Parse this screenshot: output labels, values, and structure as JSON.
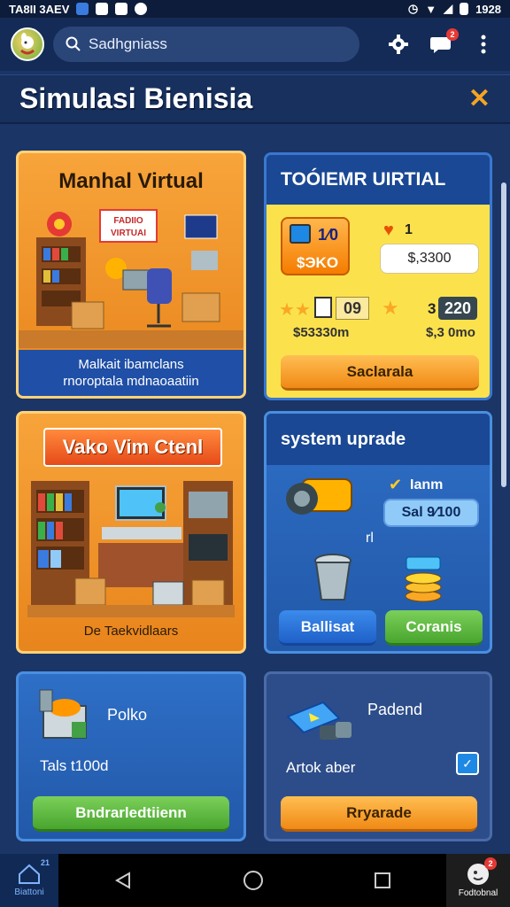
{
  "status": {
    "left_text": "TA8II 3AEV",
    "time": "1928"
  },
  "search": {
    "placeholder": "Sadhgniass"
  },
  "notifications": {
    "count": "2"
  },
  "page": {
    "title": "Simulasi Bienisia"
  },
  "shop_card": {
    "title": "Manhal Virtual",
    "sign_text": "FADIIO\nVIRTUAI",
    "caption_line1": "Malkait ibamclans",
    "caption_line2": "rnoroptala mdnaoaatiin"
  },
  "tokens_card": {
    "title": "TOÓIEMR UIRTIAL",
    "item1_value": "1⁄0",
    "item1_price": "$ЭKO",
    "item2_value": "1",
    "item2_price": "$,3300",
    "stat1_value": "09",
    "stat1_price": "$53330m",
    "stat2_value": "220",
    "stat2_prefix": "3",
    "stat2_price": "$,3 0mo",
    "button_label": "Saclarala"
  },
  "office_card": {
    "title": "Vako Vim Ctenl",
    "caption": "De Taekvidlaars"
  },
  "upgrade_card": {
    "title": "system uprade",
    "label1": "Ianm",
    "pill": "Sal 9∕100",
    "marker": "rl",
    "button_left": "Ballisat",
    "button_right": "Coranis"
  },
  "pack_card_left": {
    "title": "Polko",
    "subtitle": "Tals t100d",
    "button_label": "Bndrarledtiienn"
  },
  "pack_card_right": {
    "title": "Padend",
    "subtitle": "Artok aber",
    "button_label": "Rryarade"
  },
  "nav": {
    "home_label": "Biattoni",
    "home_badge": "21",
    "profile_label": "Fodtobnal",
    "profile_badge": "2"
  },
  "colors": {
    "background": "#1a3566",
    "orange_card": "#f7a43a",
    "yellow_card": "#fbe24d",
    "blue_card": "#2e6fc7",
    "accent_close": "#f4a423"
  }
}
